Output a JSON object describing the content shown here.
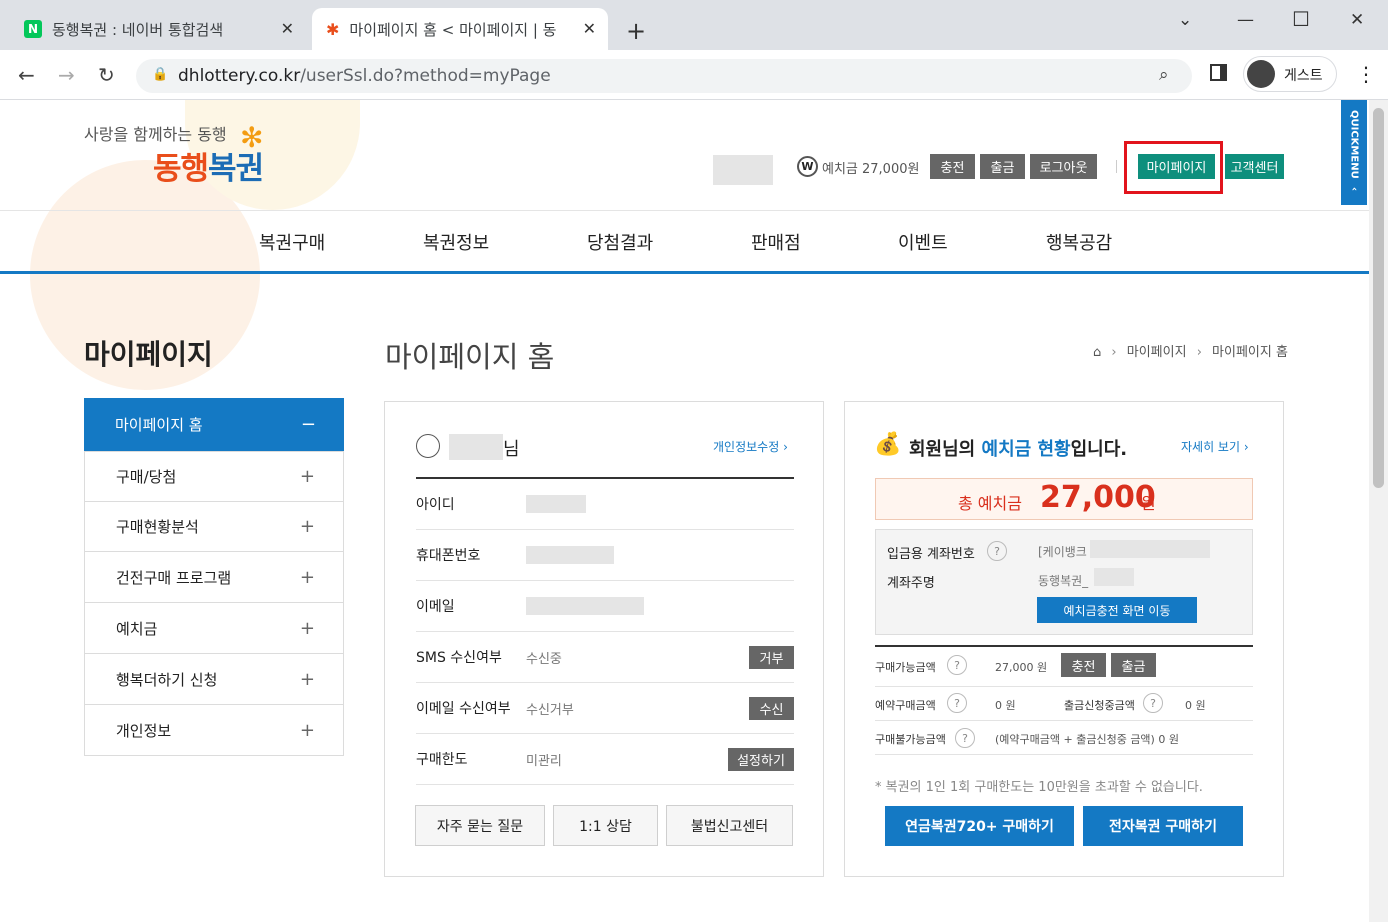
{
  "browser": {
    "tabs": [
      {
        "title": "동행복권 : 네이버 통합검색"
      },
      {
        "title": "마이페이지 홈 < 마이페이지 | 동"
      }
    ],
    "url_host": "dhlottery.co.kr",
    "url_path": "/userSsl.do?method=myPage",
    "profile_label": "게스트"
  },
  "header": {
    "logo_tagline": "사랑을 함께하는 동행",
    "logo_part1": "동행",
    "logo_part2": "복권",
    "deposit_text": "예치금 27,000원",
    "buttons": [
      "충전",
      "출금",
      "로그아웃"
    ],
    "mypage": "마이페이지",
    "support": "고객센터",
    "quickmenu": "QUICKMENU"
  },
  "gnb": [
    "복권구매",
    "복권정보",
    "당첨결과",
    "판매점",
    "이벤트",
    "행복공감"
  ],
  "lnb": {
    "title": "마이페이지",
    "items": [
      {
        "label": "마이페이지 홈",
        "sign": "−"
      },
      {
        "label": "구매/당첨",
        "sign": "+"
      },
      {
        "label": "구매현황분석",
        "sign": "+"
      },
      {
        "label": "건전구매 프로그램",
        "sign": "+"
      },
      {
        "label": "예치금",
        "sign": "+"
      },
      {
        "label": "행복더하기 신청",
        "sign": "+"
      },
      {
        "label": "개인정보",
        "sign": "+"
      }
    ]
  },
  "main": {
    "title": "마이페이지 홈",
    "breadcrumb": [
      "마이페이지",
      "마이페이지 홈"
    ],
    "user_suffix": "님",
    "edit_link": "개인정보수정",
    "info_rows": [
      {
        "label": "아이디",
        "value": "",
        "button": ""
      },
      {
        "label": "휴대폰번호",
        "value": "",
        "button": ""
      },
      {
        "label": "이메일",
        "value": "",
        "button": ""
      },
      {
        "label": "SMS 수신여부",
        "value": "수신중",
        "button": "거부"
      },
      {
        "label": "이메일 수신여부",
        "value": "수신거부",
        "button": "수신"
      },
      {
        "label": "구매한도",
        "value": "미관리",
        "button": "설정하기"
      }
    ],
    "bottom_buttons": [
      "자주 묻는 질문",
      "1:1 상담",
      "불법신고센터"
    ]
  },
  "deposit": {
    "heading_a": "회원님의 ",
    "heading_b": "예치금 현황",
    "heading_c": "입니다.",
    "detail_link": "자세히 보기",
    "total_label": "총 예치금",
    "total_value": "27,000",
    "total_unit": "원",
    "account_label": "입금용 계좌번호",
    "account_value": "[케이뱅크",
    "holder_label": "계좌주명",
    "holder_value": "동행복권_",
    "move_btn": "예치금충전 화면 이동",
    "available_label": "구매가능금액",
    "available_value": "27,000 원",
    "charge_btn": "충전",
    "withdraw_btn": "출금",
    "reserved_label": "예약구매금액",
    "reserved_value": "0 원",
    "withdraw_req_label": "출금신청중금액",
    "withdraw_req_value": "0 원",
    "unavailable_label": "구매불가능금액",
    "unavailable_value": "(예약구매금액 + 출금신청중 금액)  0 원",
    "notice": "* 복권의 1인 1회 구매한도는 10만원을 초과할 수 없습니다.",
    "buy_btn1": "연금복권720+ 구매하기",
    "buy_btn2": "전자복권 구매하기"
  }
}
